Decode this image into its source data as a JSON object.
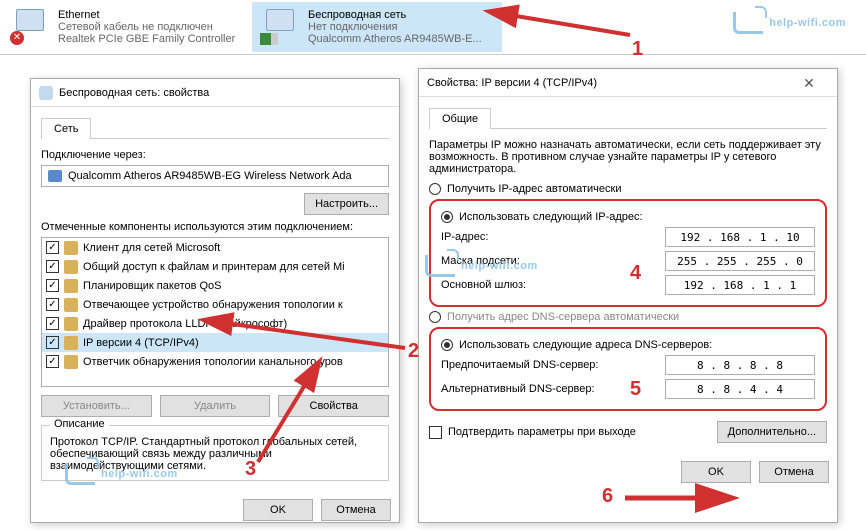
{
  "adapters": [
    {
      "name": "Ethernet",
      "status": "Сетевой кабель не подключен",
      "dev": "Realtek PCIe GBE Family Controller",
      "disconnected": true
    },
    {
      "name": "Беспроводная сеть",
      "status": "Нет подключения",
      "dev": "Qualcomm Atheros AR9485WB-E...",
      "selected": true
    }
  ],
  "watermark": "help-wifi.com",
  "propsDlg": {
    "title": "Беспроводная сеть: свойства",
    "tab": "Сеть",
    "connectVia": "Подключение через:",
    "adapter": "Qualcomm Atheros AR9485WB-EG Wireless Network Ada",
    "configure": "Настроить...",
    "compLabel": "Отмеченные компоненты используются этим подключением:",
    "items": [
      "Клиент для сетей Microsoft",
      "Общий доступ к файлам и принтерам для сетей Mi",
      "Планировщик пакетов QoS",
      "Отвечающее устройство обнаружения топологии к",
      "Драйвер протокола LLDP (Майкрософт)",
      "IP версии 4 (TCP/IPv4)",
      "Ответчик обнаружения топологии канального уров"
    ],
    "selIndex": 5,
    "install": "Установить...",
    "remove": "Удалить",
    "props": "Свойства",
    "descTitle": "Описание",
    "desc": "Протокол TCP/IP. Стандартный протокол глобальных сетей, обеспечивающий связь между различными взаимодействующими сетями.",
    "ok": "OK",
    "cancel": "Отмена"
  },
  "ipDlg": {
    "title": "Свойства: IP версии 4 (TCP/IPv4)",
    "tab": "Общие",
    "intro": "Параметры IP можно назначать автоматически, если сеть поддерживает эту возможность. В противном случае узнайте параметры IP у сетевого администратора.",
    "autoIp": "Получить IP-адрес автоматически",
    "manIp": "Использовать следующий IP-адрес:",
    "ipLbl": "IP-адрес:",
    "ip": "192 . 168 .  1  . 10",
    "maskLbl": "Маска подсети:",
    "mask": "255 . 255 . 255 .  0",
    "gwLbl": "Основной шлюз:",
    "gw": "192 . 168 .  1  .  1",
    "autoDns": "Получить адрес DNS-сервера автоматически",
    "manDns": "Использовать следующие адреса DNS-серверов:",
    "dns1Lbl": "Предпочитаемый DNS-сервер:",
    "dns1": "8  .  8  .  8  .  8",
    "dns2Lbl": "Альтернативный DNS-сервер:",
    "dns2": "8  .  8  .  4  .  4",
    "confirm": "Подтвердить параметры при выходе",
    "adv": "Дополнительно...",
    "ok": "OK",
    "cancel": "Отмена"
  },
  "anno": {
    "1": "1",
    "2": "2",
    "3": "3",
    "4": "4",
    "5": "5",
    "6": "6"
  }
}
